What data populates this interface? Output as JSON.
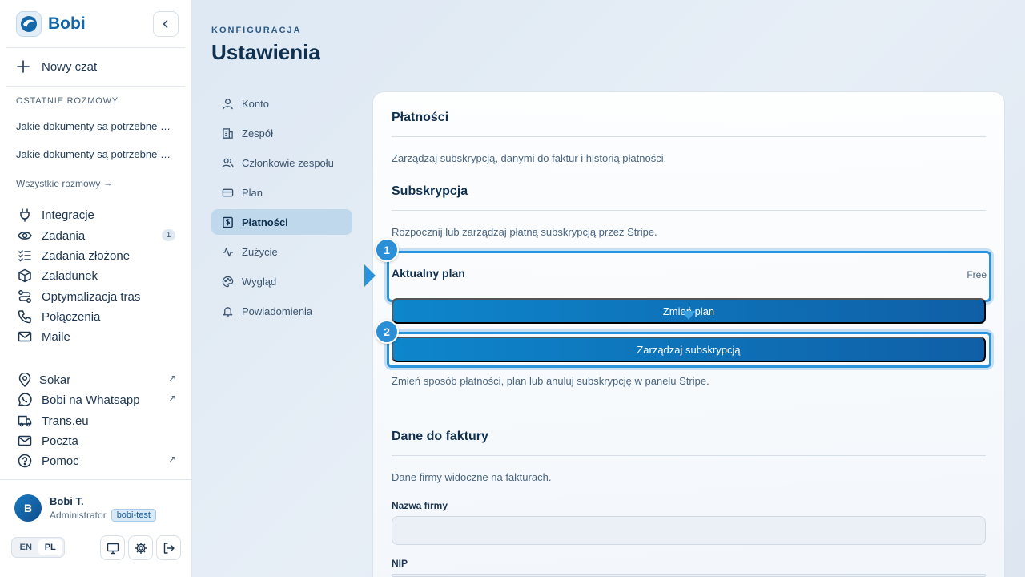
{
  "brand": {
    "name": "Bobi"
  },
  "sidebar": {
    "new_chat": "Nowy czat",
    "recent_title": "OSTATNIE ROZMOWY",
    "recent": [
      "Jakie dokumenty sa potrzebne do przewozu",
      "Jakie dokumenty są potrzebne do przewozu"
    ],
    "all_chats": "Wszystkie rozmowy",
    "nav": [
      {
        "label": "Integracje",
        "icon": "plug-icon"
      },
      {
        "label": "Zadania",
        "icon": "eye-icon",
        "badge": "1"
      },
      {
        "label": "Zadania złożone",
        "icon": "checklist-icon"
      },
      {
        "label": "Załadunek",
        "icon": "box-icon"
      },
      {
        "label": "Optymalizacja tras",
        "icon": "route-icon"
      },
      {
        "label": "Połączenia",
        "icon": "phone-icon"
      },
      {
        "label": "Maile",
        "icon": "mail-icon"
      }
    ],
    "links": [
      {
        "label": "Sokar",
        "icon": "location-icon",
        "external": true
      },
      {
        "label": "Bobi na Whatsapp",
        "icon": "whatsapp-icon",
        "external": true
      },
      {
        "label": "Trans.eu",
        "icon": "truck-icon",
        "external": false
      },
      {
        "label": "Poczta",
        "icon": "mail-icon",
        "external": false
      },
      {
        "label": "Pomoc",
        "icon": "help-icon",
        "external": true
      }
    ],
    "user": {
      "initial": "B",
      "name": "Bobi T.",
      "role": "Administrator",
      "tag": "bobi-test"
    },
    "lang": {
      "en": "EN",
      "pl": "PL",
      "selected": "PL"
    }
  },
  "header": {
    "eyebrow": "KONFIGURACJA",
    "title": "Ustawienia"
  },
  "settings_nav": [
    {
      "label": "Konto",
      "icon": "user-icon"
    },
    {
      "label": "Zespół",
      "icon": "building-icon"
    },
    {
      "label": "Członkowie zespołu",
      "icon": "users-icon"
    },
    {
      "label": "Plan",
      "icon": "card-icon"
    },
    {
      "label": "Płatności",
      "icon": "dollar-doc-icon",
      "active": true
    },
    {
      "label": "Zużycie",
      "icon": "activity-icon"
    },
    {
      "label": "Wygląd",
      "icon": "palette-icon"
    },
    {
      "label": "Powiadomienia",
      "icon": "bell-icon"
    }
  ],
  "payments": {
    "title": "Płatności",
    "description": "Zarządzaj subskrypcją, danymi do faktur i historią płatności.",
    "subscription": {
      "title": "Subskrypcja",
      "description": "Rozpocznij lub zarządzaj płatną subskrypcją przez Stripe.",
      "current_plan_label": "Aktualny plan",
      "current_plan_value": "Free",
      "change_plan": "Zmień plan",
      "manage": "Zarządzaj subskrypcją",
      "note": "Zmień sposób płatności, plan lub anuluj subskrypcję w panelu Stripe."
    },
    "invoice": {
      "title": "Dane do faktury",
      "description": "Dane firmy widoczne na fakturach.",
      "company_label": "Nazwa firmy",
      "company_value": "",
      "nip_label": "NIP",
      "nip_value": ""
    },
    "markers": [
      "1",
      "2"
    ]
  },
  "colors": {
    "accent": "#1667a8",
    "button_start": "#0e86cc",
    "button_end": "#0f5fa6",
    "highlight": "#2b93db"
  }
}
